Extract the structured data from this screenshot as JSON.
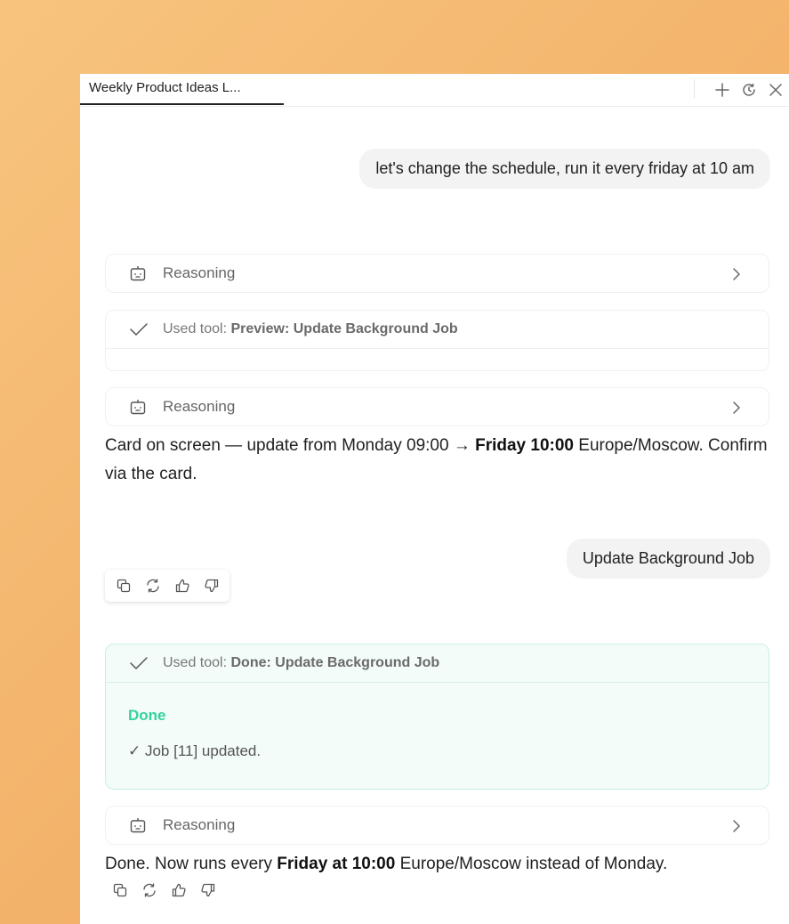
{
  "tab": {
    "title": "Weekly Product Ideas L..."
  },
  "tab_actions": [
    "plus-icon",
    "history-icon",
    "close-icon"
  ],
  "messages": {
    "user1": "let's change the schedule, run it every friday at 10 am",
    "reasoning_label": "Reasoning",
    "tool1": {
      "prefix": "Used tool: ",
      "name": "Preview: Update Background Job"
    },
    "assistant1": {
      "part1": "Card on screen — update from Monday 09:00 → ",
      "bold": "Friday 10:00",
      "part2": " Europe/Moscow. Confirm via the card."
    },
    "user2": "Update Background Job",
    "tool2": {
      "prefix": "Used tool: ",
      "name": "Done: Update Background Job",
      "status": "Done",
      "result": "✓ Job [11] updated."
    },
    "assistant2": {
      "part1": "Done. Now runs every ",
      "bold": "Friday at 10:00",
      "part2": " Europe/Moscow instead of Monday."
    }
  },
  "colors": {
    "done_green": "#36d29b",
    "done_bg": "#f3fcf9"
  }
}
